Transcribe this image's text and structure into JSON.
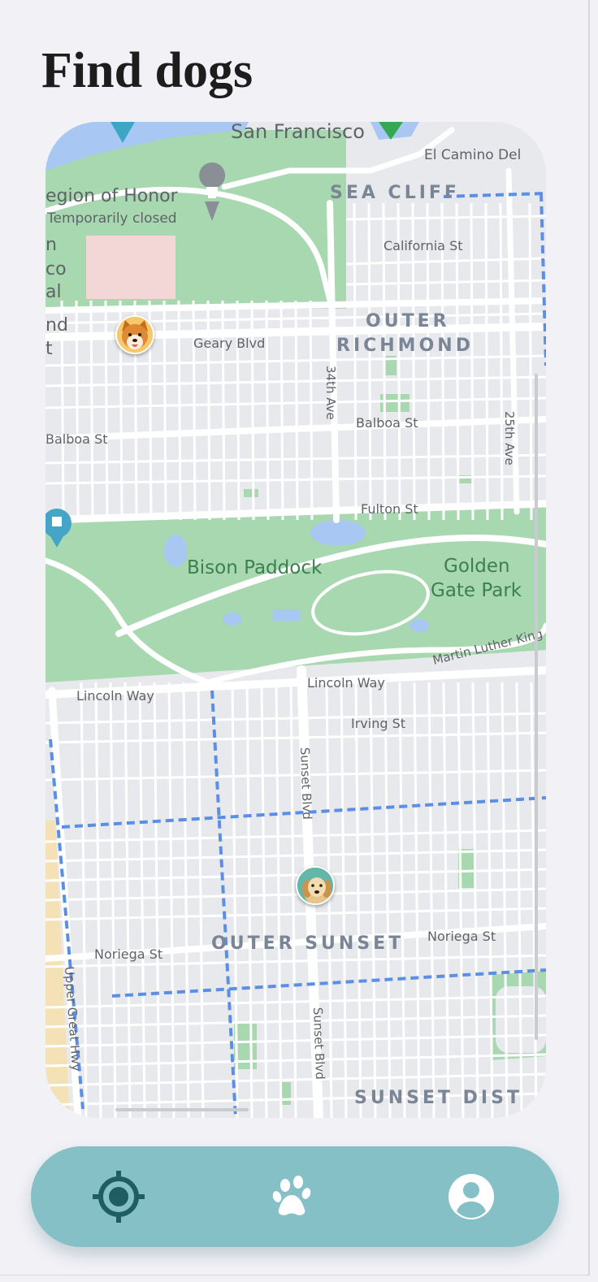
{
  "page": {
    "title": "Find dogs"
  },
  "map": {
    "labels": {
      "san_francisco": "San Francisco",
      "el_camino": "El Camino Del",
      "legion_of_honor": "egion of Honor",
      "temporarily_closed": "Temporarily closed",
      "sea_cliff": "SEA CLIFF",
      "california_st": "California St",
      "outer_richmond_1": "OUTER",
      "outer_richmond_2": "RICHMOND",
      "geary_blvd": "Geary Blvd",
      "ave_34th": "34th Ave",
      "ave_25th": "25th Ave",
      "balboa_st_left": "Balboa St",
      "balboa_st_right": "Balboa St",
      "fulton_st": "Fulton St",
      "bison_paddock": "Bison Paddock",
      "golden_gate_1": "Golden",
      "golden_gate_2": "Gate Park",
      "mlk": "Martin Luther King",
      "lincoln_way_left": "Lincoln Way",
      "lincoln_way_right": "Lincoln Way",
      "irving_st": "Irving St",
      "sunset_blvd_1": "Sunset Blvd",
      "sunset_blvd_2": "Sunset Blvd",
      "outer_sunset": "OUTER SUNSET",
      "noriega_st_left": "Noriega St",
      "noriega_st_right": "Noriega St",
      "upper_great_hwy": "Upper Great Hwy",
      "sunset_dist": "SUNSET DIST",
      "edge_n": "n",
      "edge_co": "co",
      "edge_al": "al",
      "edge_nd": "nd",
      "edge_t": "t"
    },
    "markers": [
      {
        "name": "dog-marker-shiba",
        "breed_icon": "shiba-inu"
      },
      {
        "name": "dog-marker-golden",
        "breed_icon": "golden-retriever"
      }
    ],
    "colors": {
      "land": "#e8e9ed",
      "park": "#a8d8b0",
      "water": "#a8c7f2",
      "road": "#ffffff",
      "boundary": "#5b8fe6",
      "beach": "#f4e2b6"
    }
  },
  "navbar": {
    "background": "#84c0c5",
    "items": [
      {
        "icon": "locate-icon",
        "active": true
      },
      {
        "icon": "paw-icon",
        "active": false
      },
      {
        "icon": "profile-icon",
        "active": false
      }
    ]
  }
}
